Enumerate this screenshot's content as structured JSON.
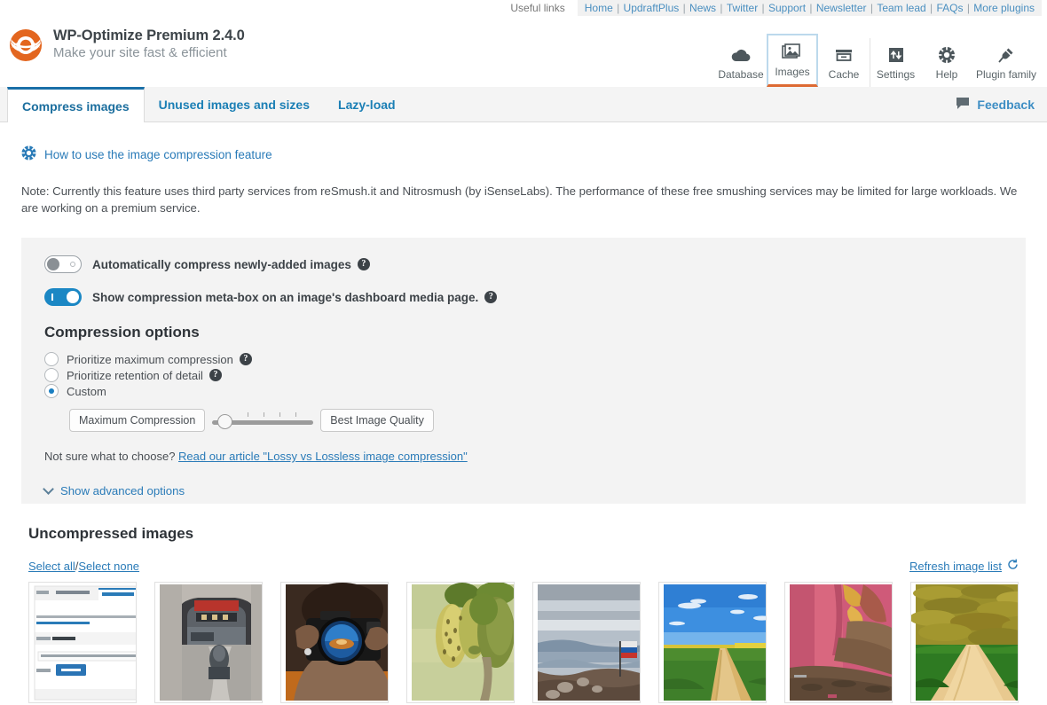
{
  "useful": {
    "label": "Useful links",
    "links": [
      "Home",
      "UpdraftPlus",
      "News",
      "Twitter",
      "Support",
      "Newsletter",
      "Team lead",
      "FAQs",
      "More plugins"
    ]
  },
  "brand": {
    "title": "WP-Optimize Premium 2.4.0",
    "subtitle": "Make your site fast & efficient",
    "logo_color": "#e3661f"
  },
  "topnav": {
    "items": [
      {
        "label": "Database",
        "icon": "cloud-icon",
        "active": false
      },
      {
        "label": "Images",
        "icon": "images-icon",
        "active": true
      },
      {
        "label": "Cache",
        "icon": "cache-icon",
        "active": false
      },
      {
        "label": "Settings",
        "icon": "settings-icon",
        "active": false
      },
      {
        "label": "Help",
        "icon": "help-icon",
        "active": false
      },
      {
        "label": "Plugin family",
        "icon": "plug-icon",
        "active": false
      }
    ],
    "active_border_color": "#bcd9ec",
    "active_underline_color": "#dd6a33"
  },
  "tabs": {
    "items": [
      {
        "label": "Compress images",
        "active": true
      },
      {
        "label": "Unused images and sizes",
        "active": false
      },
      {
        "label": "Lazy-load",
        "active": false
      }
    ],
    "feedback_label": "Feedback",
    "active_color": "#1a6fa8"
  },
  "howto": {
    "icon": "lifebuoy-icon",
    "label": "How to use the image compression feature"
  },
  "note": {
    "text": "Note: Currently this feature uses third party services from reSmush.it and Nitrosmush (by iSenseLabs). The performance of these free smushing services may be limited for large workloads. We are working on a premium service."
  },
  "settings": {
    "toggles": [
      {
        "label": "Automatically compress newly-added images",
        "state": "off",
        "help": "?"
      },
      {
        "label": "Show compression meta-box on an image's dashboard media page.",
        "state": "on",
        "help": "?"
      }
    ],
    "compression_options_title": "Compression options",
    "radios": [
      {
        "label": "Prioritize maximum compression",
        "checked": false,
        "help": "?"
      },
      {
        "label": "Prioritize retention of detail",
        "checked": false,
        "help": "?"
      },
      {
        "label": "Custom",
        "checked": true,
        "help": ""
      }
    ],
    "slider": {
      "left_label": "Maximum Compression",
      "right_label": "Best Image Quality",
      "value_percent": 8,
      "tick_count": 4
    },
    "not_sure_prefix": "Not sure what to choose? ",
    "not_sure_link": "Read our article \"Lossy vs Lossless image compression\"",
    "advanced_label": "Show advanced options",
    "advanced_icon": "chevron-down-icon",
    "accent_color": "#1b87c4"
  },
  "uncompressed": {
    "title": "Uncompressed images",
    "select_all": "Select all",
    "separator": " / ",
    "select_none": "Select none",
    "refresh_label": "Refresh image list",
    "refresh_icon": "refresh-icon",
    "thumbnails": [
      {
        "name": "settings-screenshot-thumb",
        "kind": "screenshot"
      },
      {
        "name": "doorway-thumb",
        "kind": "doorway"
      },
      {
        "name": "photographer-camera-thumb",
        "kind": "camera"
      },
      {
        "name": "papaya-fruit-thumb",
        "kind": "fruit"
      },
      {
        "name": "mountain-flag-thumb",
        "kind": "mountain"
      },
      {
        "name": "country-road-thumb",
        "kind": "road"
      },
      {
        "name": "pink-wall-thumb",
        "kind": "pinkwall"
      },
      {
        "name": "yellow-field-path-thumb",
        "kind": "field"
      }
    ]
  }
}
